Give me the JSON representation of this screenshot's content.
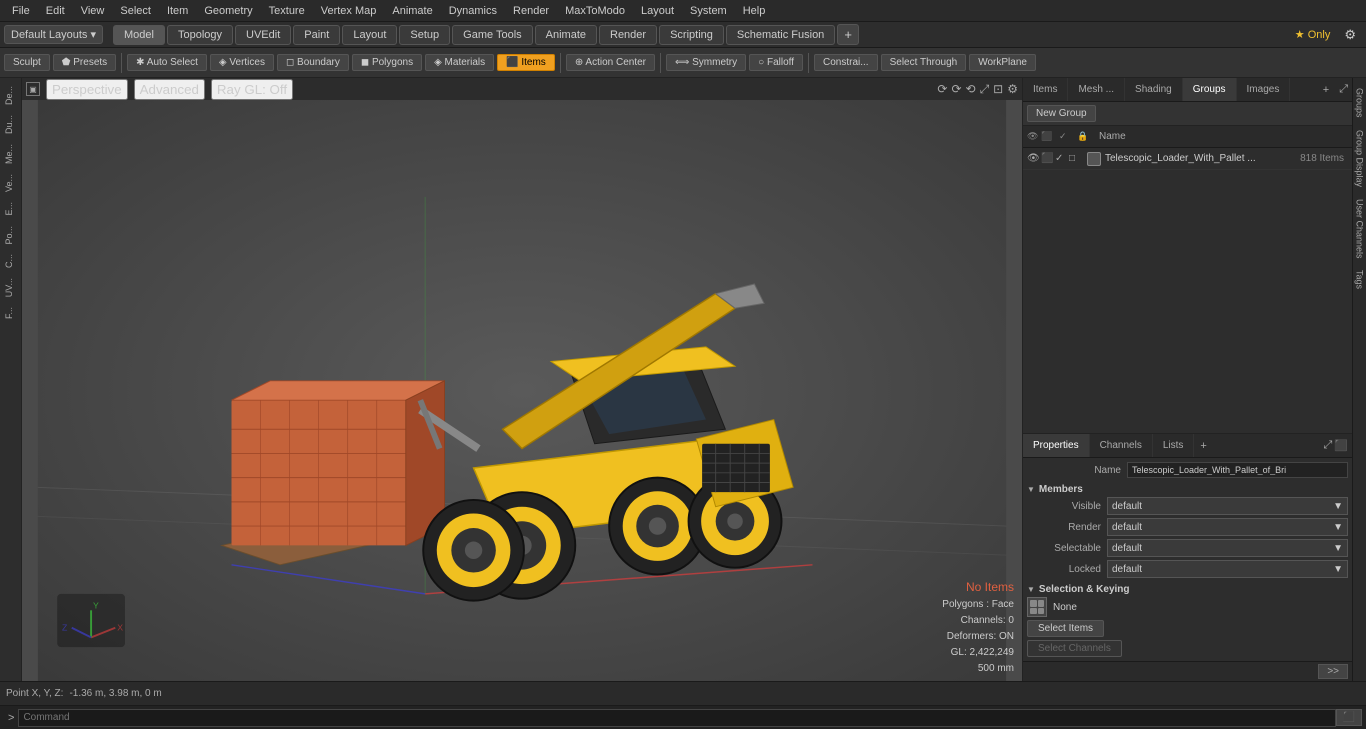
{
  "menu": {
    "items": [
      "File",
      "Edit",
      "View",
      "Select",
      "Item",
      "Geometry",
      "Texture",
      "Vertex Map",
      "Animate",
      "Dynamics",
      "Render",
      "MaxToModo",
      "Layout",
      "System",
      "Help"
    ]
  },
  "layout_bar": {
    "dropdown_label": "Default Layouts ▾",
    "tabs": [
      "Model",
      "Topology",
      "UVEdit",
      "Paint",
      "Layout",
      "Setup",
      "Game Tools",
      "Animate",
      "Render",
      "Scripting",
      "Schematic Fusion"
    ],
    "active_tab": "Model",
    "scripting_label": "Scripting",
    "plus_label": "+",
    "star_label": "★ Only",
    "gear_label": "⚙"
  },
  "toolbar": {
    "sculpt_label": "Sculpt",
    "presets_label": "Presets",
    "auto_select_label": "Auto Select",
    "vertices_label": "Vertices",
    "boundary_label": "Boundary",
    "polygons_label": "Polygons",
    "materials_label": "Materials",
    "items_label": "Items",
    "action_center_label": "Action Center",
    "symmetry_label": "Symmetry",
    "falloff_label": "Falloff",
    "constraints_label": "Constrai...",
    "select_through_label": "Select Through",
    "workplane_label": "WorkPlane"
  },
  "viewport": {
    "perspective_label": "Perspective",
    "advanced_label": "Advanced",
    "ray_gl_label": "Ray GL: Off",
    "status": {
      "no_items": "No Items",
      "polygons": "Polygons : Face",
      "channels": "Channels: 0",
      "deformers": "Deformers: ON",
      "gl": "GL: 2,422,249",
      "size": "500 mm"
    }
  },
  "groups_panel": {
    "tabs": [
      "Items",
      "Mesh ...",
      "Shading",
      "Groups",
      "Images"
    ],
    "active_tab": "Groups",
    "new_group_label": "New Group",
    "col_name": "Name",
    "item": {
      "name": "Telescopic_Loader_With_Pallet ...",
      "count": "818 Items"
    }
  },
  "properties_panel": {
    "tabs": [
      "Properties",
      "Channels",
      "Lists"
    ],
    "active_tab": "Properties",
    "add_label": "+",
    "name_label": "Name",
    "name_value": "Telescopic_Loader_With_Pallet_of_Bri",
    "members_section": "Members",
    "visible_label": "Visible",
    "visible_value": "default",
    "render_label": "Render",
    "render_value": "default",
    "selectable_label": "Selectable",
    "selectable_value": "default",
    "locked_label": "Locked",
    "locked_value": "default",
    "selection_keying_section": "Selection & Keying",
    "keying_icon_label": "None",
    "select_items_label": "Select Items",
    "select_channels_label": "Select Channels"
  },
  "right_vtabs": [
    "Groups",
    "Group Display",
    "User Channels",
    "Tags"
  ],
  "bottom_bar": {
    "position_label": "Point X, Y, Z:",
    "position_value": "-1.36 m, 3.98 m, 0 m"
  },
  "cmd_bar": {
    "expand_label": ">",
    "placeholder": "Command",
    "run_label": "⬛"
  },
  "left_sidebar": {
    "tabs": [
      "De...",
      "Du...",
      "Me...",
      "Ve...",
      "E...",
      "Po...",
      "C...",
      "UV...",
      "F..."
    ]
  }
}
